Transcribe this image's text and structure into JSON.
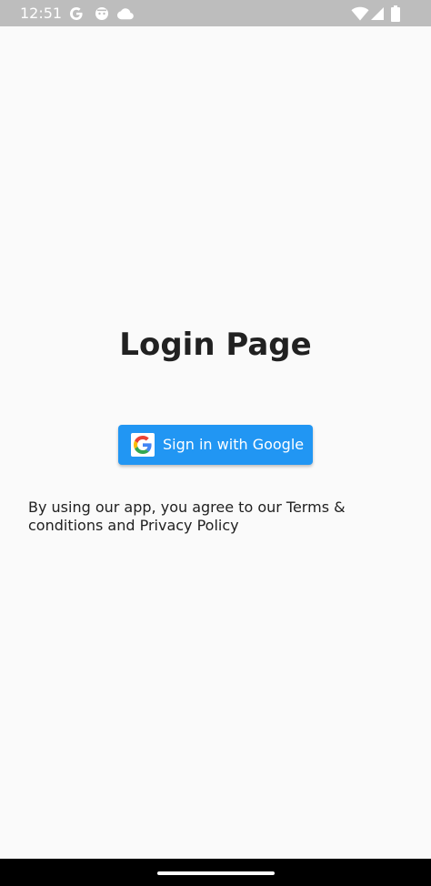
{
  "status_bar": {
    "time": "12:51",
    "icons": [
      "google-notification-icon",
      "android-notification-icon",
      "cloud-icon",
      "wifi-icon",
      "signal-icon",
      "battery-icon"
    ]
  },
  "login": {
    "title": "Login Page",
    "google_button_label": "Sign in with Google",
    "terms_text": "By using our app, you agree to our Terms & conditions and Privacy Policy"
  },
  "colors": {
    "background": "#fafafa",
    "status_bar": "#bdbdbd",
    "button": "#2196f3",
    "text": "#212121",
    "nav_bar": "#000000"
  }
}
